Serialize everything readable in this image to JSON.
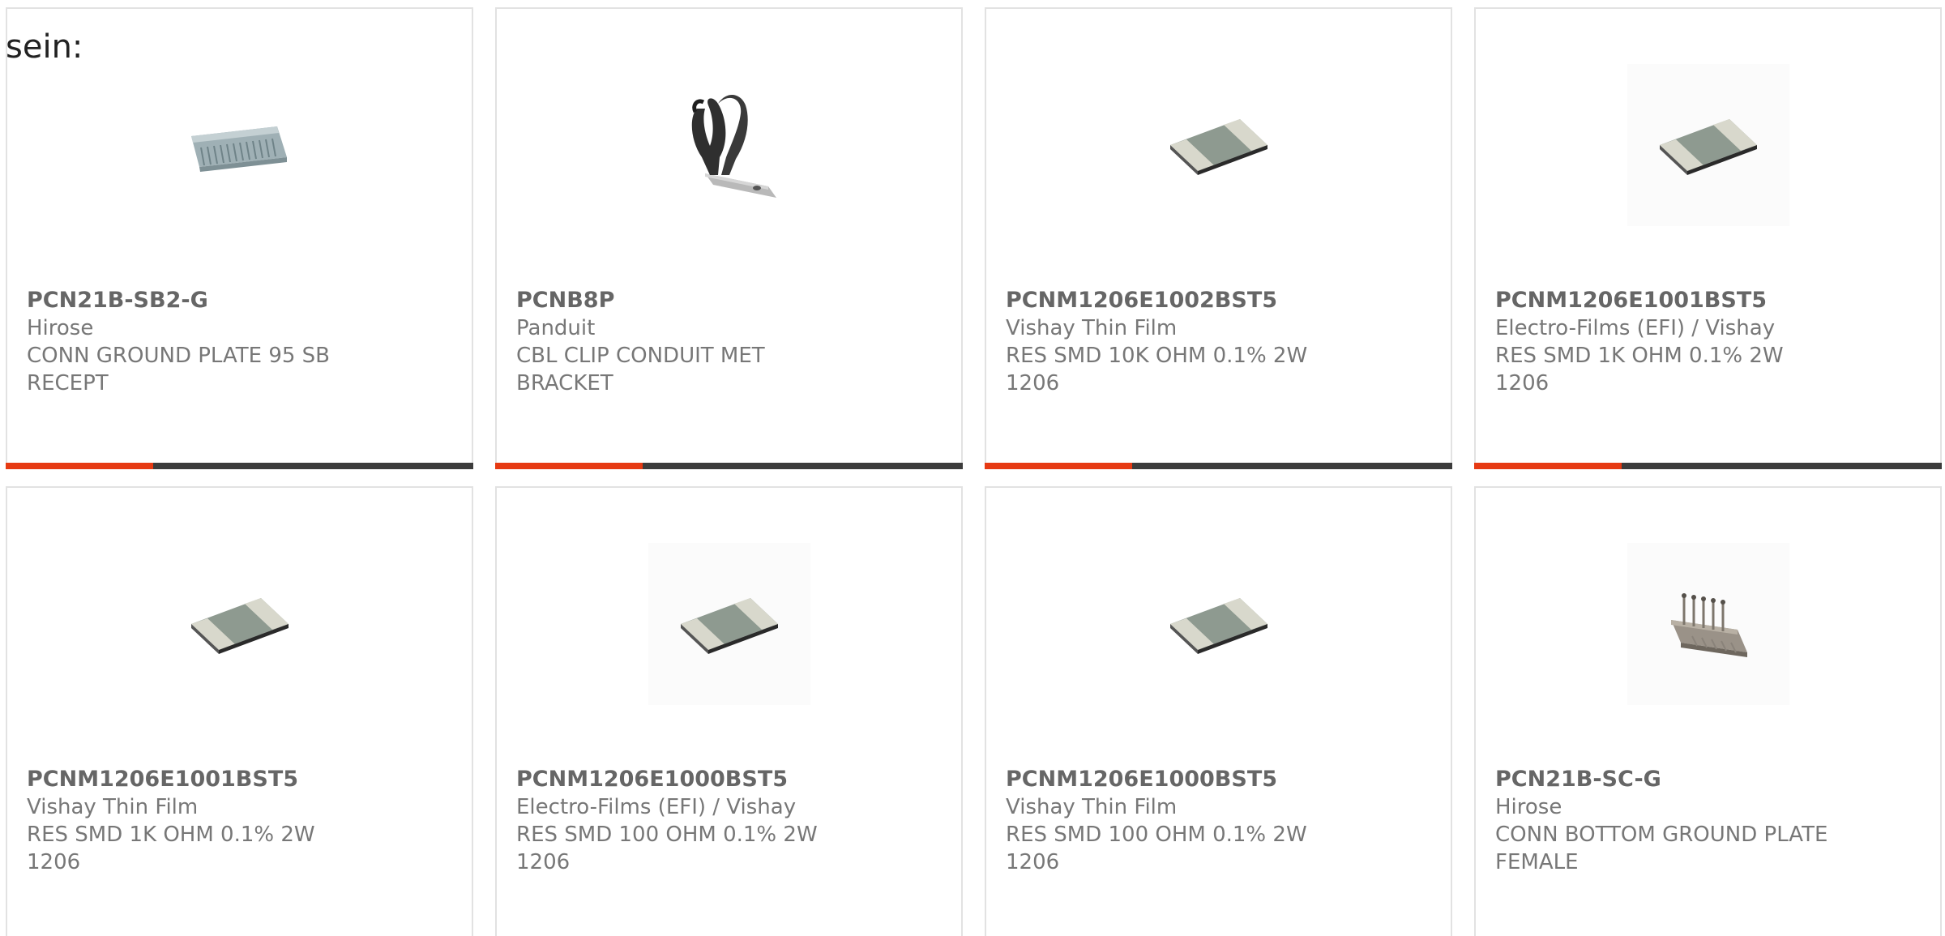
{
  "intro_text": "sein:",
  "colors": {
    "accent": "#e63a13",
    "bar": "#3c3c3c",
    "border": "#e2e2e2",
    "text": "#777777"
  },
  "products": [
    {
      "part_number": "PCN21B-SB2-G",
      "manufacturer": "Hirose",
      "description": "CONN GROUND PLATE 95 SB RECEPT",
      "icon": "connector-strip-icon"
    },
    {
      "part_number": "PCNB8P",
      "manufacturer": "Panduit",
      "description": "CBL CLIP CONDUIT MET BRACKET",
      "icon": "conduit-clip-icon"
    },
    {
      "part_number": "PCNM1206E1002BST5",
      "manufacturer": "Vishay Thin Film",
      "description": "RES SMD 10K OHM 0.1% 2W 1206",
      "icon": "smd-resistor-icon"
    },
    {
      "part_number": "PCNM1206E1001BST5",
      "manufacturer": "Electro-Films (EFI) / Vishay",
      "description": "RES SMD 1K OHM 0.1% 2W 1206",
      "icon": "smd-resistor-icon"
    },
    {
      "part_number": "PCNM1206E1001BST5",
      "manufacturer": "Vishay Thin Film",
      "description": "RES SMD 1K OHM 0.1% 2W 1206",
      "icon": "smd-resistor-icon"
    },
    {
      "part_number": "PCNM1206E1000BST5",
      "manufacturer": "Electro-Films (EFI) / Vishay",
      "description": "RES SMD 100 OHM 0.1% 2W 1206",
      "icon": "smd-resistor-icon"
    },
    {
      "part_number": "PCNM1206E1000BST5",
      "manufacturer": "Vishay Thin Film",
      "description": "RES SMD 100 OHM 0.1% 2W 1206",
      "icon": "smd-resistor-icon"
    },
    {
      "part_number": "PCN21B-SC-G",
      "manufacturer": "Hirose",
      "description": "CONN BOTTOM GROUND PLATE FEMALE",
      "icon": "ground-plate-connector-icon"
    }
  ]
}
